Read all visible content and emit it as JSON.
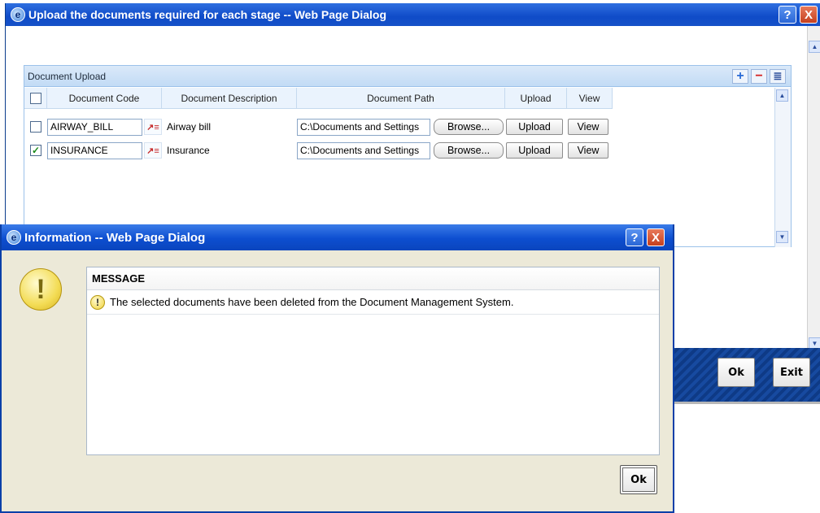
{
  "main_window": {
    "title": "Upload the documents required for each stage -- Web Page Dialog",
    "help_label": "?",
    "close_label": "X"
  },
  "document_upload": {
    "title": "Document Upload",
    "tools": {
      "add": "+",
      "delete": "−",
      "view": "≣"
    },
    "columns": [
      "Document Code",
      "Document Description",
      "Document Path",
      "Upload",
      "View"
    ],
    "rows": [
      {
        "checked": false,
        "code": "AIRWAY_BILL",
        "description": "Airway bill",
        "path": "C:\\Documents and Settings",
        "browse": "Browse...",
        "upload": "Upload",
        "view": "View"
      },
      {
        "checked": true,
        "code": "INSURANCE",
        "description": "Insurance",
        "path": "C:\\Documents and Settings",
        "browse": "Browse...",
        "upload": "Upload",
        "view": "View"
      }
    ]
  },
  "actions": {
    "ok_label": "Ok",
    "exit_label": "Exit"
  },
  "info_dialog": {
    "title": "Information -- Web Page Dialog",
    "help_label": "?",
    "close_label": "X",
    "heading": "MESSAGE",
    "message": "The selected documents have been deleted from the Document Management System.",
    "ok_label": "Ok"
  },
  "colors": {
    "titlebar": "#0f4bc8",
    "panel_header": "#c2dbf5",
    "dialog_bg": "#ece9d8"
  }
}
